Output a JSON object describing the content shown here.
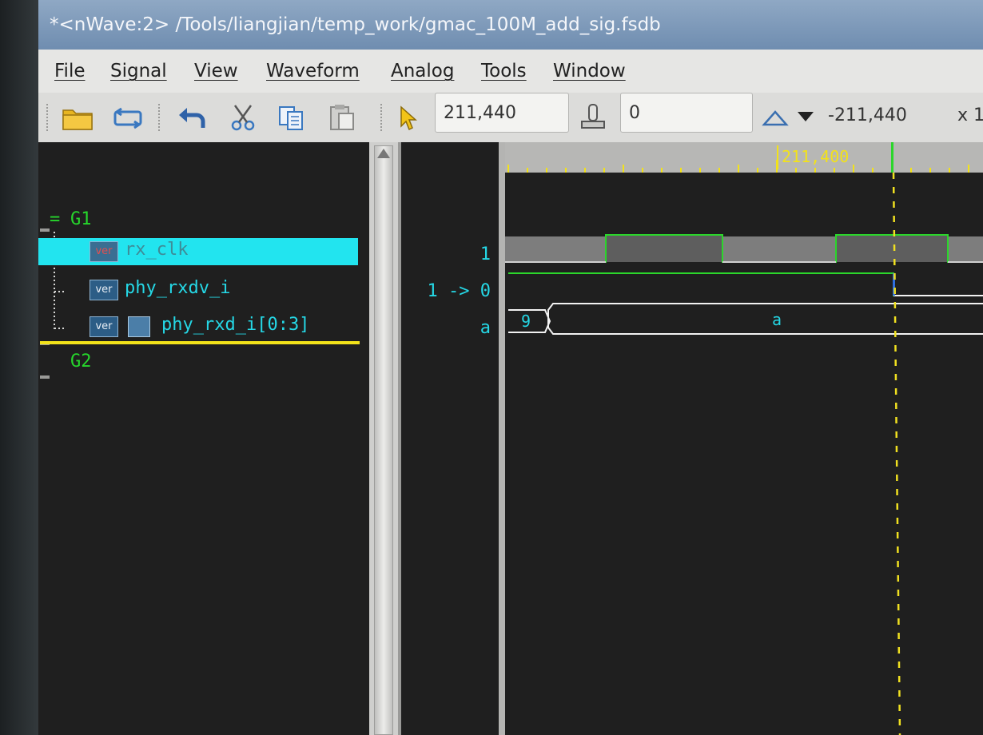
{
  "window": {
    "title": "*<nWave:2> /Tools/liangjian/temp_work/gmac_100M_add_sig.fsdb"
  },
  "menu": [
    {
      "label": "File"
    },
    {
      "label": "Signal"
    },
    {
      "label": "View"
    },
    {
      "label": "Waveform"
    },
    {
      "label": "Analog"
    },
    {
      "label": "Tools"
    },
    {
      "label": "Window"
    }
  ],
  "toolbar": {
    "cursor_time": "211,440",
    "marker_time": "0",
    "delta_time": "-211,440",
    "zoom_prefix": "x 1",
    "icons": [
      "open-folder-icon",
      "reload-icon",
      "undo-icon",
      "cut-icon",
      "copy-icon",
      "paste-icon",
      "pointer-icon",
      "marker-icon",
      "search-up-icon",
      "search-down-icon"
    ]
  },
  "signals": {
    "groups": [
      {
        "name": "G1",
        "prefix": "="
      },
      {
        "name": "G2",
        "prefix": ""
      }
    ],
    "badge": "ver",
    "items": [
      {
        "name": "rx_clk",
        "value": "1",
        "selected": true
      },
      {
        "name": "phy_rxdv_i",
        "value": "1 -> 0",
        "selected": false
      },
      {
        "name": "phy_rxd_i[0:3]",
        "value": "a",
        "selected": false
      }
    ]
  },
  "waveform": {
    "ruler_label": "211,400",
    "bus_values": [
      "9",
      "a"
    ],
    "colors": {
      "background": "#1f1f1f",
      "signal_high": "#2bd62b",
      "signal_line": "#f2f2f2",
      "clock_fill": "#7d7d7d",
      "cursor": "#f0e020",
      "name_text": "#25d8e6",
      "group_text": "#26d62c",
      "selection": "#22e4ef"
    }
  }
}
